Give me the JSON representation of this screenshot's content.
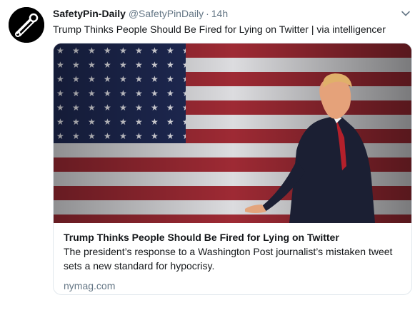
{
  "tweet": {
    "display_name": "SafetyPin-Daily",
    "handle": "@SafetyPinDaily",
    "separator": "·",
    "time": "14h",
    "text": "Trump Thinks People Should Be Fired for Lying on Twitter   | via intelligencer"
  },
  "card": {
    "title": "Trump Thinks People Should Be Fired for Lying on Twitter",
    "description_line1": "The president’s response to a Washington Post journalist’s mistaken tweet",
    "description_line2": "sets a new standard for hypocrisy.",
    "domain": "nymag.com"
  },
  "icons": {
    "avatar": "safety-pin-logo",
    "menu": "chevron-down-icon"
  },
  "colors": {
    "name_text": "#14171a",
    "meta_text": "#657786",
    "card_border": "#e1e8ed"
  }
}
